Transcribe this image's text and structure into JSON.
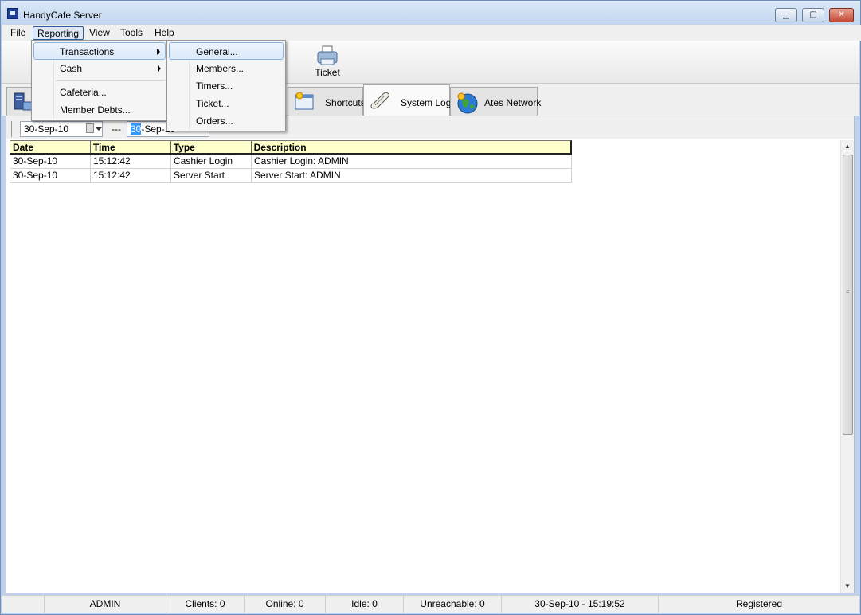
{
  "window": {
    "title": "HandyCafe Server"
  },
  "menubar": {
    "items": [
      "File",
      "Reporting",
      "View",
      "Tools",
      "Help"
    ],
    "active": "Reporting"
  },
  "toolbar": {
    "ticket_label": "Ticket"
  },
  "tabs": [
    {
      "label": "Shortcuts",
      "icon": "shortcuts-icon"
    },
    {
      "label": "System Log",
      "icon": "scroll-icon",
      "selected": true
    },
    {
      "label": "Ates Network",
      "icon": "globe-icon"
    }
  ],
  "reporting_menu": {
    "items": [
      "Transactions",
      "Cash",
      "Cafeteria...",
      "Member Debts..."
    ]
  },
  "transactions_submenu": {
    "items": [
      "General...",
      "Members...",
      "Timers...",
      "Ticket...",
      "Orders..."
    ]
  },
  "datebar": {
    "from_date": "30-Sep-10",
    "separator": "---",
    "to_date_selected": "30",
    "to_date_rest": "-Sep-10"
  },
  "grid": {
    "columns": [
      "Date",
      "Time",
      "Type",
      "Description"
    ],
    "rows": [
      [
        "30-Sep-10",
        "15:12:42",
        "Cashier Login",
        "Cashier Login: ADMIN"
      ],
      [
        "30-Sep-10",
        "15:12:42",
        "Server Start",
        "Server Start: ADMIN"
      ]
    ]
  },
  "statusbar": {
    "user": "ADMIN",
    "clients": "Clients: 0",
    "online": "Online: 0",
    "idle": "Idle: 0",
    "unreachable": "Unreachable: 0",
    "datetime": "30-Sep-10 - 15:19:52",
    "registration": "Registered"
  },
  "colors": {
    "grid_header": "#ffffcc",
    "menu_highlight": "#dbe9fa",
    "selection": "#3399ff"
  }
}
